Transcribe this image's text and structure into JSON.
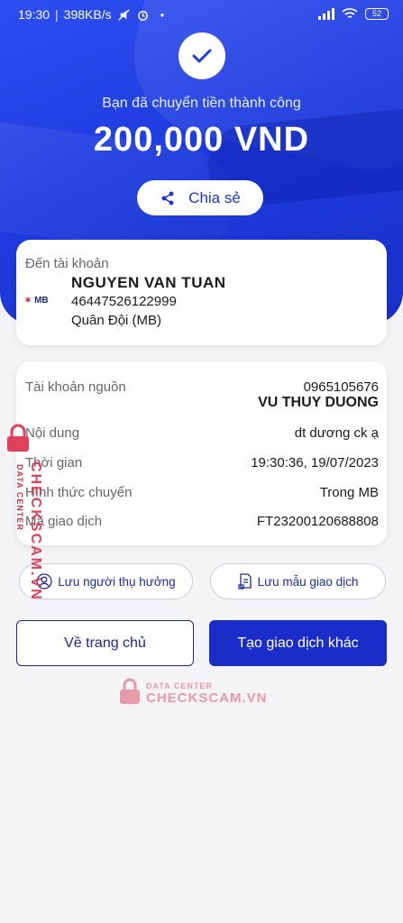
{
  "status_bar": {
    "time": "19:30",
    "network_speed": "398KB/s",
    "battery": "52"
  },
  "hero": {
    "success_message": "Bạn đã chuyển tiền thành công",
    "amount": "200,000  VND",
    "share_label": "Chia sẻ"
  },
  "destination": {
    "label": "Đến tài khoản",
    "bank_logo_text": "MB",
    "name": "NGUYEN VAN TUAN",
    "account_number": "46447526122999",
    "bank_name": "Quân Đội (MB)"
  },
  "details": {
    "source_label": "Tài khoản nguồn",
    "source_account": "0965105676",
    "source_name": "VU THUY DUONG",
    "content_label": "Nội dung",
    "content_value": "dt dương ck ạ",
    "time_label": "Thời gian",
    "time_value": "19:30:36, 19/07/2023",
    "method_label": "Hình thức chuyển",
    "method_value": "Trong MB",
    "txn_label": "Mã giao dịch",
    "txn_value": "FT23200120688808"
  },
  "actions": {
    "save_beneficiary": "Lưu người thụ hưởng",
    "save_template": "Lưu mẫu giao dịch",
    "home": "Về trang chủ",
    "new_transaction": "Tạo giao dịch khác"
  },
  "watermark": {
    "brand": "CHECKSCAM.VN",
    "sub": "DATA CENTER"
  },
  "colors": {
    "primary": "#1a2cc7",
    "hero": "#1e3cdf",
    "watermark": "#e0405a"
  }
}
